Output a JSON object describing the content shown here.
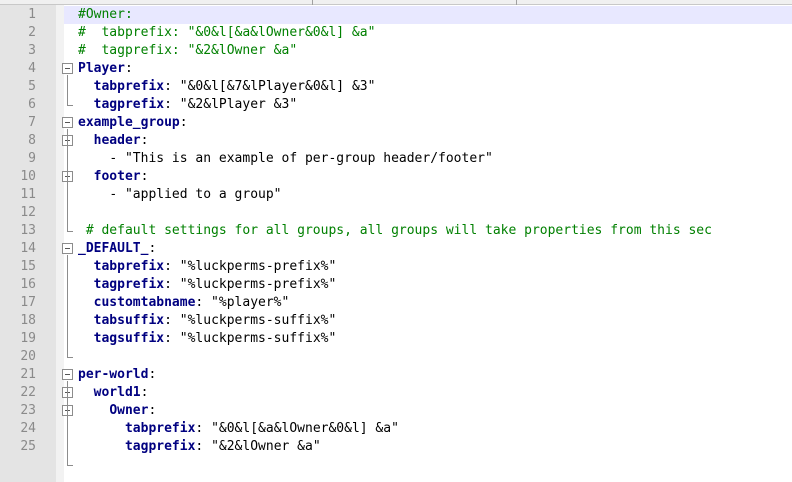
{
  "lines": [
    {
      "n": "1",
      "indent": "",
      "parts": [
        [
          "c",
          "#Owner:"
        ]
      ]
    },
    {
      "n": "2",
      "indent": "",
      "parts": [
        [
          "c",
          "#  tabprefix: \"&0&l[&a&lOwner&0&l] &a\""
        ]
      ]
    },
    {
      "n": "3",
      "indent": "",
      "parts": [
        [
          "c",
          "#  tagprefix: \"&2&lOwner &a\""
        ]
      ]
    },
    {
      "n": "4",
      "indent": "",
      "parts": [
        [
          "k",
          "Player"
        ],
        [
          "s",
          ":"
        ]
      ]
    },
    {
      "n": "5",
      "indent": "  ",
      "parts": [
        [
          "k",
          "tabprefix"
        ],
        [
          "s",
          ": \"&0&l[&7&lPlayer&0&l] &3\""
        ]
      ]
    },
    {
      "n": "6",
      "indent": "  ",
      "parts": [
        [
          "k",
          "tagprefix"
        ],
        [
          "s",
          ": \"&2&lPlayer &3\""
        ]
      ]
    },
    {
      "n": "7",
      "indent": "",
      "parts": [
        [
          "k",
          "example_group"
        ],
        [
          "s",
          ":"
        ]
      ]
    },
    {
      "n": "8",
      "indent": "  ",
      "parts": [
        [
          "k",
          "header"
        ],
        [
          "s",
          ":"
        ]
      ]
    },
    {
      "n": "9",
      "indent": "    ",
      "parts": [
        [
          "s",
          "- \"This is an example of per-group header/footer\""
        ]
      ]
    },
    {
      "n": "10",
      "indent": "  ",
      "parts": [
        [
          "k",
          "footer"
        ],
        [
          "s",
          ":"
        ]
      ]
    },
    {
      "n": "11",
      "indent": "    ",
      "parts": [
        [
          "s",
          "- \"applied to a group\""
        ]
      ]
    },
    {
      "n": "12",
      "indent": "",
      "parts": []
    },
    {
      "n": "13",
      "indent": " ",
      "parts": [
        [
          "c",
          "# default settings for all groups, all groups will take properties from this sec"
        ]
      ]
    },
    {
      "n": "14",
      "indent": "",
      "parts": [
        [
          "k",
          "_DEFAULT_"
        ],
        [
          "s",
          ":"
        ]
      ]
    },
    {
      "n": "15",
      "indent": "  ",
      "parts": [
        [
          "k",
          "tabprefix"
        ],
        [
          "s",
          ": \"%luckperms-prefix%\""
        ]
      ]
    },
    {
      "n": "16",
      "indent": "  ",
      "parts": [
        [
          "k",
          "tagprefix"
        ],
        [
          "s",
          ": \"%luckperms-prefix%\""
        ]
      ]
    },
    {
      "n": "17",
      "indent": "  ",
      "parts": [
        [
          "k",
          "customtabname"
        ],
        [
          "s",
          ": \"%player%\""
        ]
      ]
    },
    {
      "n": "18",
      "indent": "  ",
      "parts": [
        [
          "k",
          "tabsuffix"
        ],
        [
          "s",
          ": \"%luckperms-suffix%\""
        ]
      ]
    },
    {
      "n": "19",
      "indent": "  ",
      "parts": [
        [
          "k",
          "tagsuffix"
        ],
        [
          "s",
          ": \"%luckperms-suffix%\""
        ]
      ]
    },
    {
      "n": "20",
      "indent": "",
      "parts": []
    },
    {
      "n": "21",
      "indent": "",
      "parts": [
        [
          "k",
          "per-world"
        ],
        [
          "s",
          ":"
        ]
      ]
    },
    {
      "n": "22",
      "indent": "  ",
      "parts": [
        [
          "k",
          "world1"
        ],
        [
          "s",
          ":"
        ]
      ]
    },
    {
      "n": "23",
      "indent": "    ",
      "parts": [
        [
          "k",
          "Owner"
        ],
        [
          "s",
          ":"
        ]
      ]
    },
    {
      "n": "24",
      "indent": "      ",
      "parts": [
        [
          "k",
          "tabprefix"
        ],
        [
          "s",
          ": \"&0&l[&a&lOwner&0&l] &a\""
        ]
      ]
    },
    {
      "n": "25",
      "indent": "      ",
      "parts": [
        [
          "k",
          "tagprefix"
        ],
        [
          "s",
          ": \"&2&lOwner &a\""
        ]
      ]
    }
  ],
  "colors": {
    "keyword": "#000080",
    "comment": "#008000",
    "string": "#000000",
    "current_line": "#e8e8ff"
  }
}
